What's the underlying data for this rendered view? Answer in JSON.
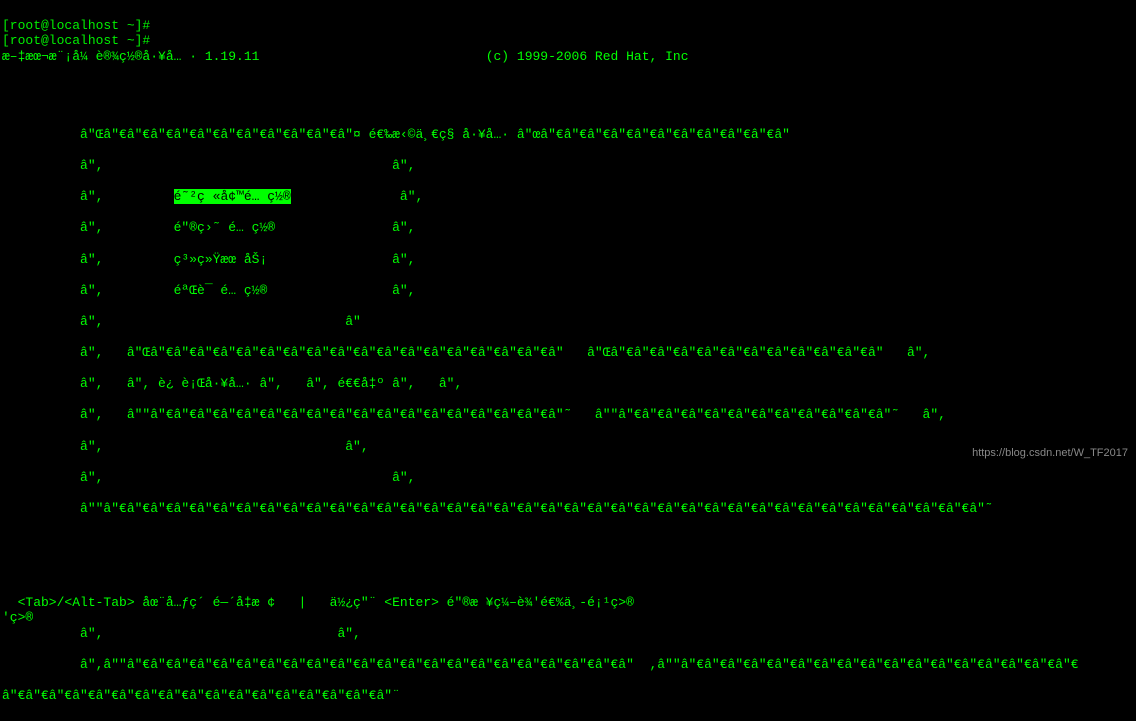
{
  "prompt_lines": {
    "line1": "[root@localhost ~]#",
    "line2": "[root@localhost ~]#"
  },
  "title_line": {
    "left": "æ–‡æœ¬æ¨¡å¼ è®¾ç½®å·¥å… · 1.19.11",
    "right": "(c) 1999-2006 Red Hat, Inc"
  },
  "box": {
    "top": "          â\"Œâ\"€â\"€â\"€â\"€â\"€â\"€â\"€â\"€â\"€â\"€â\"¤ é€‰æ‹©ä¸€ç§ å·¥å…· â\"œâ\"€â\"€â\"€â\"€â\"€â\"€â\"€â\"€â\"€â\"€â\"",
    "sp1": "          â\",                                     â\",",
    "item1": "          â\",         é˜²ç «å¢™é… ç½®              â\",",
    "item2": "          â\",         é\"®ç›˜ é… ç½®               â\",",
    "item3": "          â\",         ç³»ç»Ÿæœ åŠ¡                â\",",
    "item4": "          â\",         éªŒè¯ é… ç½®                â\",",
    "sp2": "          â\",                               â\"",
    "inner1": "          â\",   â\"Œâ\"€â\"€â\"€â\"€â\"€â\"€â\"€â\"€â\"€â\"€â\"€â\"€â\"€â\"€â\"€â\"€â\"€â\"   â\"Œâ\"€â\"€â\"€â\"€â\"€â\"€â\"€â\"€â\"€â\"€â\"€â\"   â\",",
    "inner2": "          â\",   â\", è¿ è¡Œå·¥å…· â\",   â\", é€€å‡º â\",   â\",",
    "inner3": "          â\",   â\"\"â\"€â\"€â\"€â\"€â\"€â\"€â\"€â\"€â\"€â\"€â\"€â\"€â\"€â\"€â\"€â\"€â\"€â\"˜   â\"\"â\"€â\"€â\"€â\"€â\"€â\"€â\"€â\"€â\"€â\"€â\"€â\"˜   â\",",
    "sp3": "          â\",                               â\",",
    "sp4": "          â\",                                     â\",",
    "bottom": "          â\"\"â\"€â\"€â\"€â\"€â\"€â\"€â\"€â\"€â\"€â\"€â\"€â\"€â\"€â\"€â\"€â\"€â\"€â\"€â\"€â\"€â\"€â\"€â\"€â\"€â\"€â\"€â\"€â\"€â\"€â\"€â\"€â\"€â\"€â\"€â\"€â\"€â\"€â\"˜"
  },
  "highlighted_text": "é˜²ç «å¢™é… ç½®",
  "help": {
    "line1": "  <Tab>/<Alt-Tab> åœ¨å…ƒç´ é—´å‡æ ¢   |   ä½¿ç\"¨ <Enter> é\"®æ ¥ç¼–è¾'é€%ä¸-é¡¹ç>®",
    "line2": "'ç>®"
  },
  "bottom_box": {
    "top": "          â\",                              â\",",
    "line": "          â\",â\"\"â\"€â\"€â\"€â\"€â\"€â\"€â\"€â\"€â\"€â\"€â\"€â\"€â\"€â\"€â\"€â\"€â\"€â\"€â\"€â\"€â\"€â\"  ,â\"\"â\"€â\"€â\"€â\"€â\"€â\"€â\"€â\"€â\"€â\"€â\"€â\"€â\"€â\"€â\"€â\"€â\"€",
    "bottom": "â\"€â\"€â\"€â\"€â\"€â\"€â\"€â\"€â\"€â\"€â\"€â\"€â\"€â\"€â\"€â\"€â\"¨"
  },
  "url": "https://blog.csdn.net/W_TF2017"
}
